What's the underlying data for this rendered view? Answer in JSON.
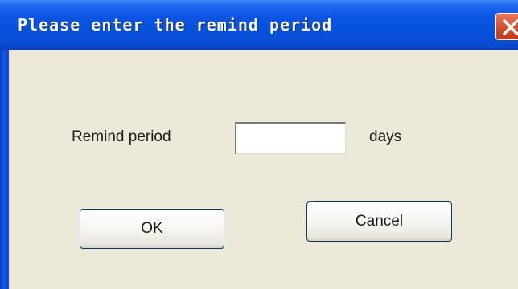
{
  "dialog": {
    "title": "Please enter the remind period",
    "close_icon": "close-icon",
    "period_label": "Remind period",
    "period_value": "",
    "days_label": "days",
    "ok_label": "OK",
    "cancel_label": "Cancel"
  },
  "colors": {
    "titlebar": "#0a55e4",
    "window_bg": "#ece9d8",
    "close_button": "#d8512f"
  }
}
